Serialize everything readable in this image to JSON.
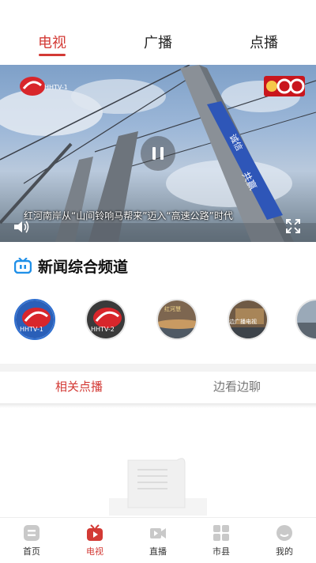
{
  "top_tabs": [
    "电视",
    "广播",
    "点播"
  ],
  "player": {
    "station_logo_text": "HHTV-1",
    "subtitle": "红河南岸从“山间铃响马帮来”迈入“高速公路”时代",
    "banner_words": [
      "诚信",
      "共赢"
    ]
  },
  "section": {
    "title": "新闻综合频道"
  },
  "channels": [
    {
      "name": "HHTV-1"
    },
    {
      "name": "HHTV-2"
    },
    {
      "name": "红河慧"
    },
    {
      "name": "边广播电视"
    },
    {
      "name": ""
    }
  ],
  "sub_tabs": [
    "相关点播",
    "边看边聊"
  ],
  "bottom_nav": [
    {
      "label": "首页",
      "icon": "home-icon"
    },
    {
      "label": "电视",
      "icon": "tv-icon"
    },
    {
      "label": "直播",
      "icon": "live-video-icon"
    },
    {
      "label": "市县",
      "icon": "grid-icon"
    },
    {
      "label": "我的",
      "icon": "profile-icon"
    }
  ],
  "colors": {
    "accent": "#d33a35",
    "inactive": "#777777"
  }
}
